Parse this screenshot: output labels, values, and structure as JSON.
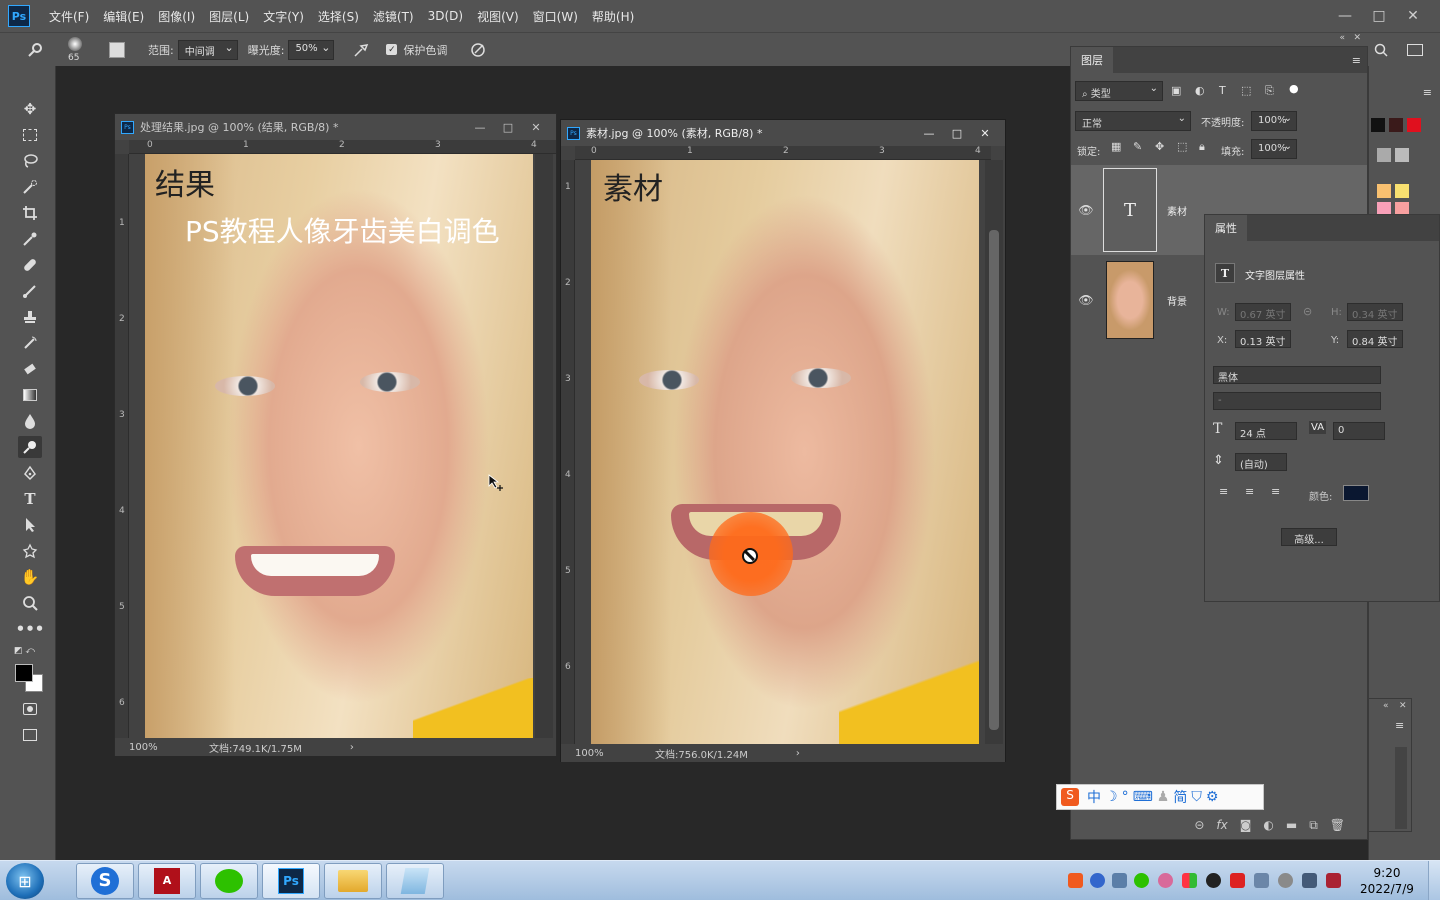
{
  "app": {
    "logo": "Ps"
  },
  "menu": [
    "文件(F)",
    "编辑(E)",
    "图像(I)",
    "图层(L)",
    "文字(Y)",
    "选择(S)",
    "滤镜(T)",
    "3D(D)",
    "视图(V)",
    "窗口(W)",
    "帮助(H)"
  ],
  "window_controls": {
    "minimize": "—",
    "maximize": "□",
    "close": "✕"
  },
  "options": {
    "brush_size": "65",
    "range_label": "范围:",
    "range_value": "中间调",
    "exposure_label": "曝光度:",
    "exposure_value": "50%",
    "protect_tones": "保护色调",
    "protect_checked": true
  },
  "tools": [
    "move-tool",
    "marquee-tool",
    "lasso-tool",
    "quick-select-tool",
    "crop-tool",
    "eyedropper-tool",
    "healing-tool",
    "brush-tool",
    "stamp-tool",
    "history-brush-tool",
    "eraser-tool",
    "gradient-tool",
    "blur-tool",
    "dodge-tool",
    "pen-tool",
    "type-tool",
    "path-select-tool",
    "shape-tool",
    "hand-tool",
    "zoom-tool",
    "more-tools"
  ],
  "doc1": {
    "title": "处理结果.jpg @ 100% (结果, RGB/8) *",
    "overlay_title": "结果",
    "overlay_subtitle": "PS教程人像牙齿美白调色",
    "zoom": "100%",
    "doc_size": "文档:749.1K/1.75M",
    "ruler_h": [
      "0",
      "1",
      "2",
      "3",
      "4"
    ],
    "ruler_v": [
      "1",
      "2",
      "3",
      "4",
      "5",
      "6"
    ]
  },
  "doc2": {
    "title": "素材.jpg @ 100% (素材, RGB/8) *",
    "overlay_title": "素材",
    "zoom": "100%",
    "doc_size": "文档:756.0K/1.24M",
    "ruler_h": [
      "0",
      "1",
      "2",
      "3",
      "4"
    ],
    "ruler_v": [
      "1",
      "2",
      "3",
      "4",
      "5",
      "6"
    ]
  },
  "layers_panel": {
    "tab": "图层",
    "filter": "类型",
    "blend_mode": "正常",
    "opacity_label": "不透明度:",
    "opacity": "100%",
    "lock_label": "锁定:",
    "fill_label": "填充:",
    "fill": "100%",
    "layers": [
      {
        "name": "素材",
        "type": "text"
      },
      {
        "name": "背景",
        "type": "image"
      }
    ]
  },
  "properties_panel": {
    "tab": "属性",
    "heading": "文字图层属性",
    "w_label": "W:",
    "w": "0.67 英寸",
    "h_label": "H:",
    "h": "0.34 英寸",
    "x_label": "X:",
    "x": "0.13 英寸",
    "y_label": "Y:",
    "y": "0.84 英寸",
    "font": "黑体",
    "style": "-",
    "size": "24 点",
    "tracking": "0",
    "leading": "(自动)",
    "color_label": "颜色:",
    "text_color": "#0a1730",
    "advanced": "高级..."
  },
  "ime_bar": [
    "中",
    "简"
  ],
  "clock": {
    "time": "9:20",
    "date": "2022/7/9"
  },
  "colors": {
    "brush_overlay": "#ff6a1a",
    "swatch_red": "#e0101e"
  }
}
